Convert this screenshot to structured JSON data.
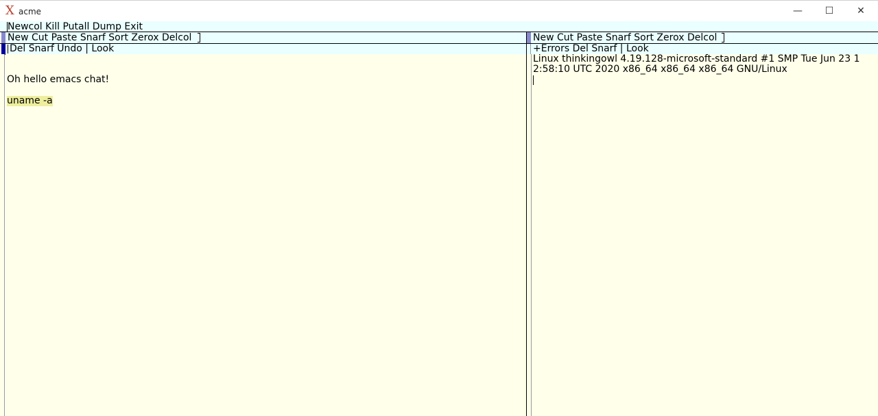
{
  "window": {
    "title": "acme",
    "minimize_glyph": "—",
    "maximize_glyph": "☐",
    "close_glyph": "✕"
  },
  "main_tag": {
    "text": "Newcol Kill Putall Dump Exit"
  },
  "left_column": {
    "tag": "New Cut Paste Snarf Sort Zerox Delcol",
    "window_tag": "Del Snarf Undo | Look",
    "lines": [
      "Oh hello emacs chat!",
      "uname -a"
    ]
  },
  "right_column": {
    "tag": "New Cut Paste Snarf Sort Zerox Delcol",
    "window_tag": "+Errors Del Snarf | Look",
    "lines": [
      "Linux thinkingowl 4.19.128-microsoft-standard #1 SMP Tue Jun 23 1",
      "2:58:10 UTC 2020 x86_64 x86_64 x86_64 GNU/Linux"
    ]
  },
  "colors": {
    "tag_bg": "#eaffff",
    "body_bg": "#ffffea",
    "handle": "#8888cc",
    "dirty_handle": "#000099",
    "selection": "#eeee9e"
  }
}
